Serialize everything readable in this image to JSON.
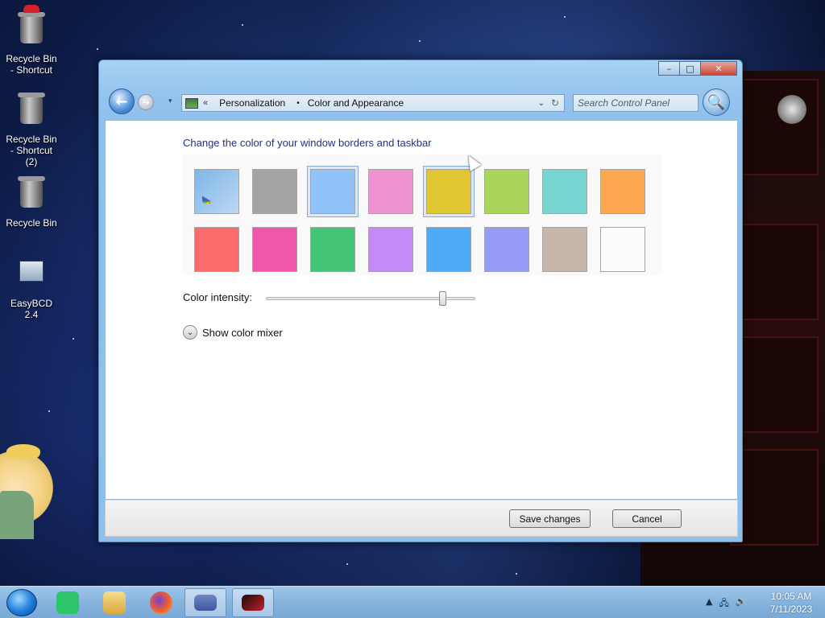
{
  "desktop": {
    "icons": [
      {
        "label": "Recycle Bin - Shortcut"
      },
      {
        "label": "Recycle Bin - Shortcut (2)"
      },
      {
        "label": "Recycle Bin"
      },
      {
        "label": "EasyBCD 2.4"
      }
    ]
  },
  "window": {
    "caption": {
      "minimize": "–",
      "maximize": "□",
      "close": "✕"
    },
    "nav": {
      "back_icon": "←",
      "forward_icon": "→",
      "recent_icon": "▾"
    },
    "address": {
      "chevron": "«",
      "crumb_1": "Personalization",
      "separator": "•",
      "crumb_2": "Color and Appearance",
      "dropdown_icon": "⌄",
      "refresh_icon": "↻"
    },
    "search": {
      "placeholder": "Search Control Panel",
      "icon": "🔍"
    }
  },
  "content": {
    "heading": "Change the color of your window borders and taskbar",
    "swatches": [
      {
        "name": "automatic",
        "color": "#7eb6e8"
      },
      {
        "name": "slate",
        "color": "#a5a5a5"
      },
      {
        "name": "sky",
        "color": "#8fc3f9",
        "selected": true
      },
      {
        "name": "pink",
        "color": "#f094d1"
      },
      {
        "name": "yellow",
        "color": "#e1c634",
        "hovered": true
      },
      {
        "name": "lime",
        "color": "#a9d55d"
      },
      {
        "name": "teal",
        "color": "#78d6d2"
      },
      {
        "name": "orange",
        "color": "#fba851"
      },
      {
        "name": "red",
        "color": "#fb6c6c"
      },
      {
        "name": "magenta",
        "color": "#ef57a9"
      },
      {
        "name": "green",
        "color": "#43c577"
      },
      {
        "name": "violet",
        "color": "#c48af5"
      },
      {
        "name": "blue",
        "color": "#4fabf7"
      },
      {
        "name": "lavender",
        "color": "#969bf8"
      },
      {
        "name": "taupe",
        "color": "#c6b6ab"
      },
      {
        "name": "white",
        "color": "#fbfbfb"
      }
    ],
    "intensity_label": "Color intensity:",
    "intensity_value": 0.86,
    "mixer_label": "Show color mixer",
    "mixer_icon": "⌄"
  },
  "footer": {
    "save_label": "Save changes",
    "cancel_label": "Cancel"
  },
  "taskbar": {
    "clock_time": "10:05 AM",
    "clock_date": "7/11/2023",
    "tray_up_icon": "▲",
    "tray_network_icon": "🖧",
    "tray_volume_icon": "🔊"
  }
}
